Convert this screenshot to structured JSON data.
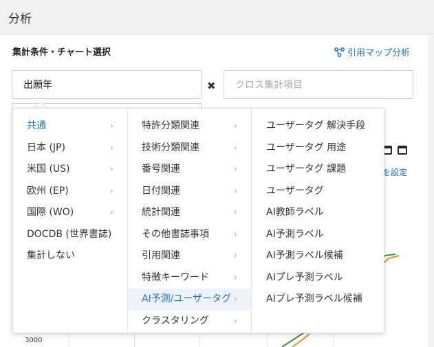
{
  "header": {
    "title": "分析"
  },
  "section": {
    "title": "集計条件・チャート選択",
    "cite_map_label": "引用マップ分析"
  },
  "fields": {
    "main_value": "出願年",
    "clear_symbol": "✖",
    "cross_placeholder": "クロス集計項目"
  },
  "background": {
    "setting_label": "を設定",
    "ytick": "3000"
  },
  "dropdown": {
    "chevron": "›",
    "col1": [
      {
        "label": "共通",
        "state": "active"
      },
      {
        "label": "日本 (JP)"
      },
      {
        "label": "米国 (US)"
      },
      {
        "label": "欧州 (EP)"
      },
      {
        "label": "国際 (WO)"
      },
      {
        "label": "DOCDB (世界書誌)"
      },
      {
        "label": "集計しない"
      }
    ],
    "col2": [
      {
        "label": "特許分類関連"
      },
      {
        "label": "技術分類関連"
      },
      {
        "label": "番号関連"
      },
      {
        "label": "日付関連"
      },
      {
        "label": "統計関連"
      },
      {
        "label": "その他書誌事項"
      },
      {
        "label": "引用関連"
      },
      {
        "label": "特徴キーワード"
      },
      {
        "label": "AI予測/ユーザータグ",
        "state": "highlight"
      },
      {
        "label": "クラスタリング"
      }
    ],
    "col3": [
      {
        "label": "ユーザータグ 解決手段"
      },
      {
        "label": "ユーザータグ 用途"
      },
      {
        "label": "ユーザータグ 課題"
      },
      {
        "label": "ユーザータグ"
      },
      {
        "label": "AI教師ラベル"
      },
      {
        "label": "AI予測ラベル"
      },
      {
        "label": "AI予測ラベル候補"
      },
      {
        "label": "AIプレ予測ラベル"
      },
      {
        "label": "AIプレ予測ラベル候補"
      }
    ]
  },
  "colors": {
    "accent": "#1a73c8",
    "highlight_bg": "#eef3fa",
    "series_green": "#3a9a3a",
    "series_orange": "#f08a1c"
  }
}
